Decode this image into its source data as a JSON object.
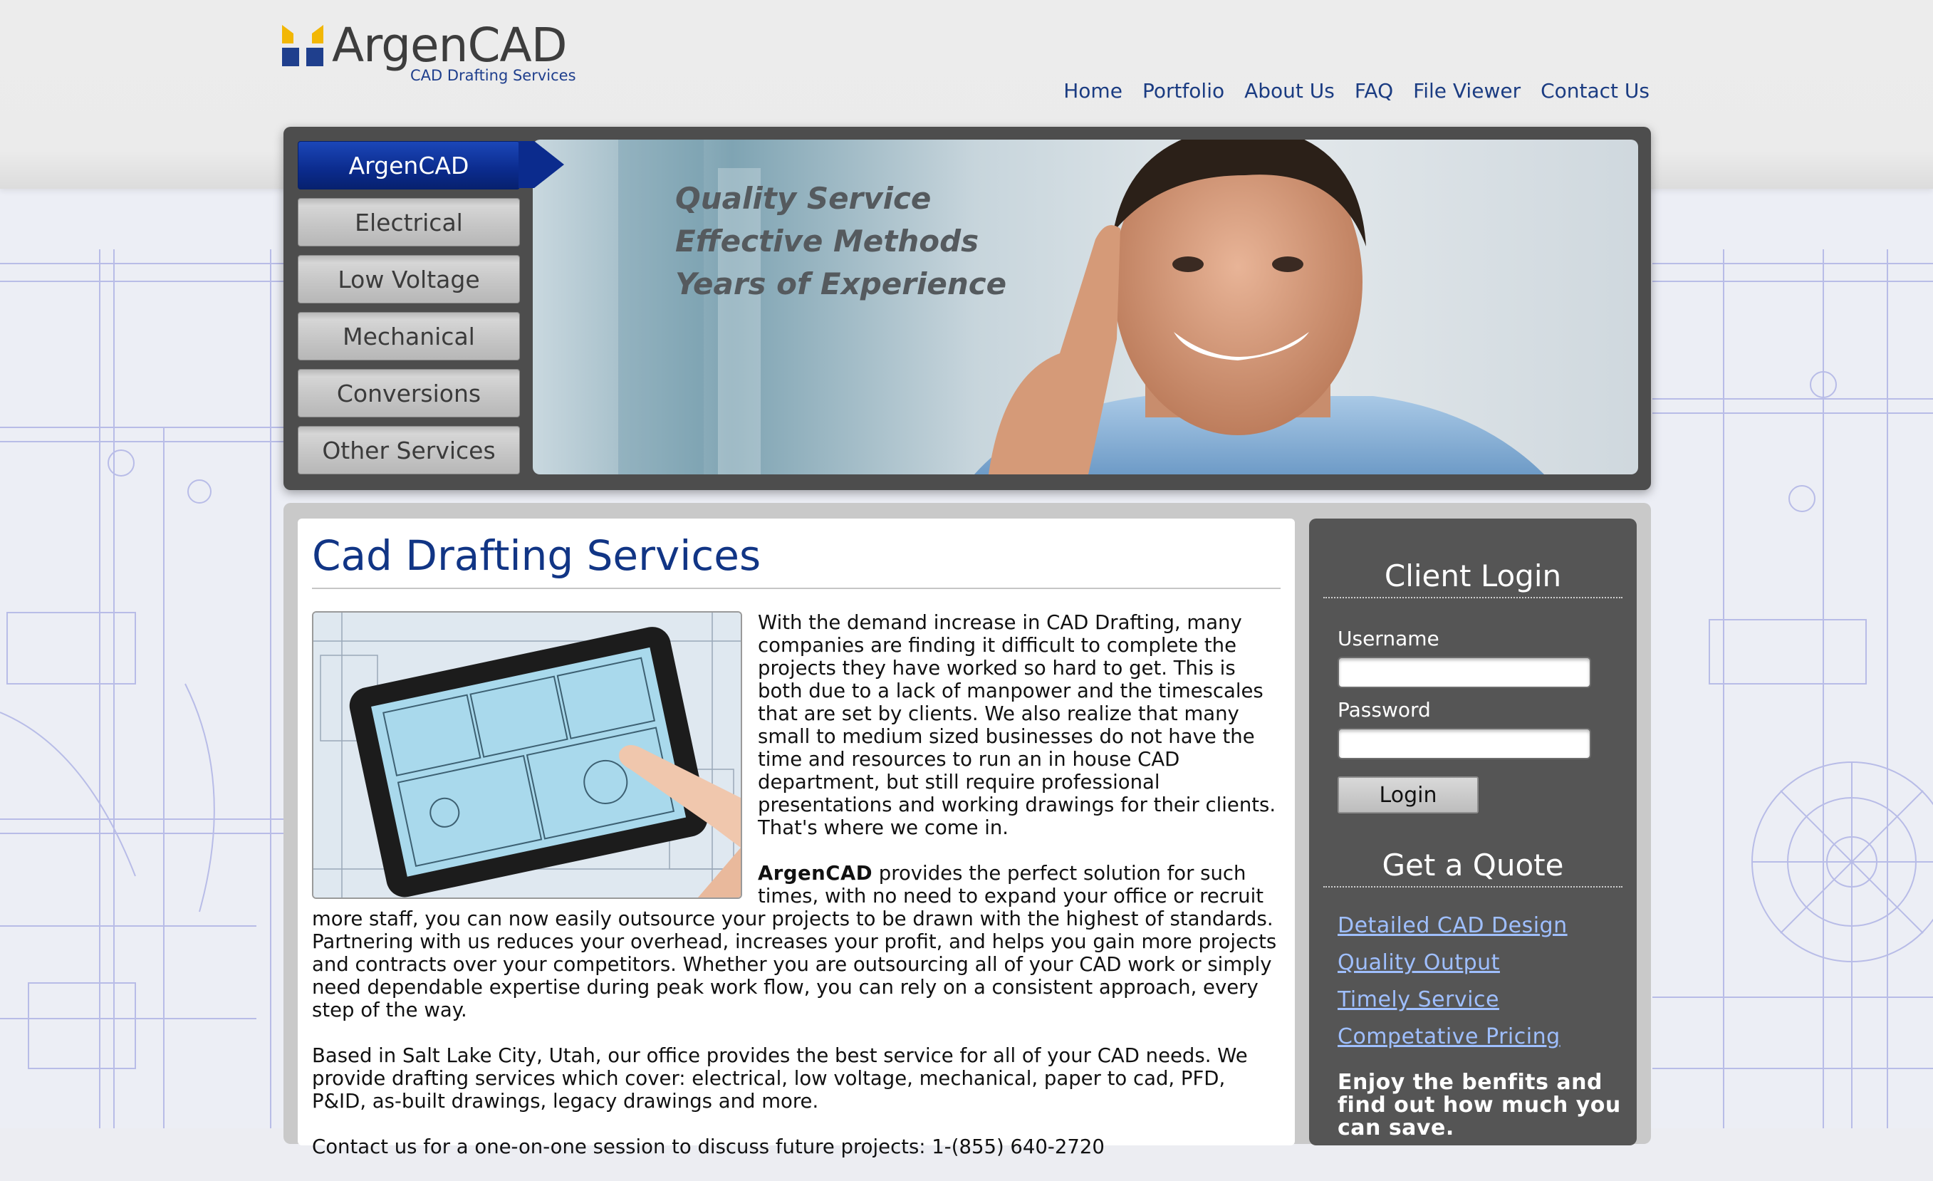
{
  "brand": {
    "name": "ArgenCAD",
    "tagline": "CAD Drafting Services",
    "colors": {
      "navy": "#1b3c82",
      "logo_yellow": "#f2b705",
      "logo_blue": "#1f3f8d"
    }
  },
  "nav": [
    "Home",
    "Portfolio",
    "About Us",
    "FAQ",
    "File Viewer",
    "Contact Us"
  ],
  "hero": {
    "tabs": [
      "ArgenCAD",
      "Electrical",
      "Low Voltage",
      "Mechanical",
      "Conversions",
      "Other Services"
    ],
    "active_tab": "ArgenCAD",
    "taglines": [
      "Quality Service",
      "Effective Methods",
      "Years of Experience"
    ]
  },
  "main": {
    "title": "Cad Drafting Services",
    "para1": "With the demand increase in CAD Drafting, many companies are finding it difficult to complete the projects they have worked so hard to get. This is both due to a lack of manpower and the timescales that are set by clients. We also realize that many small to medium sized businesses do not have the time and resources to run an in house CAD department, but still require professional presentations and working drawings for their clients. That's where we come in.",
    "para2_brand": "ArgenCAD",
    "para2_rest": " provides the perfect solution for such times, with no need to expand your office or recruit more staff, you can now easily outsource your projects to be drawn with the highest of standards. Partnering with us reduces your overhead, increases your profit, and helps you gain more projects and contracts over your competitors. Whether you are outsourcing all of your CAD work or simply need dependable expertise during peak work flow, you can rely on a consistent approach, every step of the way.",
    "para3": "Based in Salt Lake City, Utah, our office provides the best service for all of your CAD needs. We provide drafting services which cover: electrical, low voltage, mechanical, paper to cad, PFD, P&ID, as-built drawings, legacy drawings and more.",
    "para4": "Contact us for a one-on-one session to discuss future projects: 1-(855) 640-2720"
  },
  "sidebar": {
    "login_title": "Client Login",
    "username_label": "Username",
    "password_label": "Password",
    "username_value": "",
    "password_value": "",
    "login_button": "Login",
    "quote_title": "Get a Quote",
    "quote_links": [
      "Detailed CAD Design",
      "Quality Output",
      "Timely Service",
      "Competative Pricing"
    ],
    "enjoy_text": "Enjoy the benfits and find out how much you can save."
  }
}
